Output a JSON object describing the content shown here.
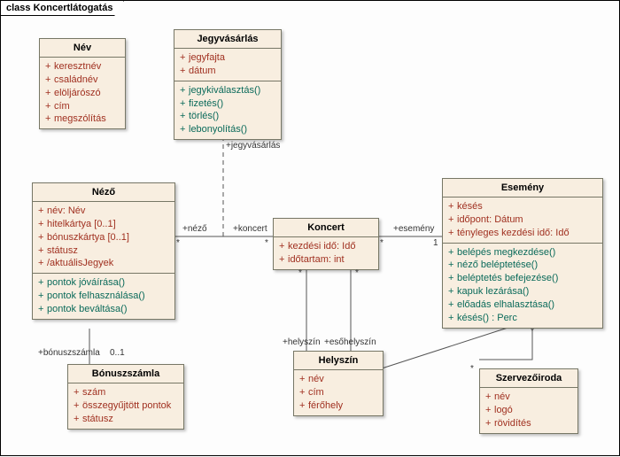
{
  "frame_label": "class Koncertlátogatás",
  "classes": {
    "nev": {
      "title": "Név",
      "attrs": [
        "keresztnév",
        "családnév",
        "elöljárószó",
        "cím",
        "megszólítás"
      ],
      "ops": []
    },
    "jegyvasarlas": {
      "title": "Jegyvásárlás",
      "attrs": [
        "jegyfajta",
        "dátum"
      ],
      "ops": [
        "jegykiválasztás()",
        "fizetés()",
        "törlés()",
        "lebonyolítás()"
      ]
    },
    "nezo": {
      "title": "Néző",
      "attrs": [
        "név:  Név",
        "hitelkártya [0..1]",
        "bónuszkártya [0..1]",
        "státusz",
        "/aktuálisJegyek"
      ],
      "ops": [
        "pontok jóváírása()",
        "pontok felhasználása()",
        "pontok beváltása()"
      ]
    },
    "koncert": {
      "title": "Koncert",
      "attrs": [
        "kezdési idő:  Idő",
        "időtartam:  int"
      ],
      "ops": []
    },
    "esemeny": {
      "title": "Esemény",
      "attrs": [
        "késés",
        "időpont:  Dátum",
        "tényleges kezdési idő:  Idő"
      ],
      "ops": [
        "belépés megkezdése()",
        "néző beléptetése()",
        "beléptetés befejezése()",
        "kapuk lezárása()",
        "előadás elhalasztása()",
        "késés() : Perc"
      ]
    },
    "bonusz": {
      "title": "Bónuszszámla",
      "attrs": [
        "szám",
        "összegyűjtött pontok",
        "státusz"
      ],
      "ops": []
    },
    "helyszin": {
      "title": "Helyszín",
      "attrs": [
        "név",
        "cím",
        "férőhely"
      ],
      "ops": []
    },
    "szervezo": {
      "title": "Szervezőiroda",
      "attrs": [
        "név",
        "logó",
        "rövidítés"
      ],
      "ops": []
    }
  },
  "labels": {
    "jegyvasarlas_role": "+jegyvásárlás",
    "nezo_role": "+néző",
    "koncert_role": "+koncert",
    "esemeny_role": "+esemény",
    "helyszin_role": "+helyszín",
    "esohelyszin_role": "+esőhelyszín",
    "bonusz_role": "+bónuszszámla",
    "mult_star1": "*",
    "mult_star2": "*",
    "mult_star3": "*",
    "mult_star4": "*",
    "mult_star5": "*",
    "mult_star6": "*",
    "mult_1": "1",
    "mult_01": "0..1"
  }
}
